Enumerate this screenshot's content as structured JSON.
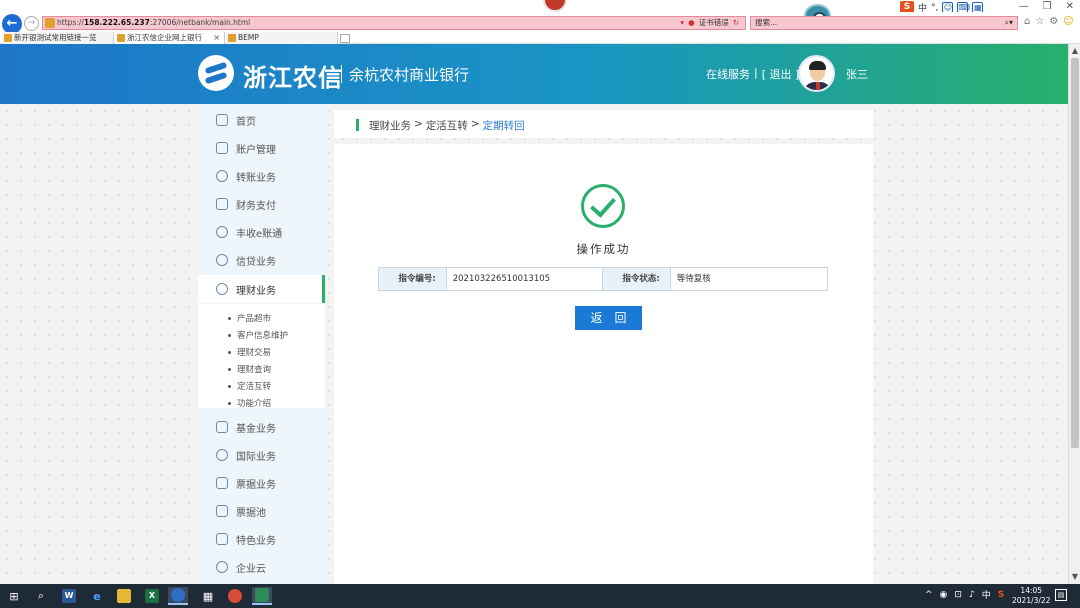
{
  "browser": {
    "url_prefix": "https://",
    "url_host": "158.222.65.237",
    "url_path": ":27006/netbank/main.html",
    "cert_error": "证书错误",
    "search_placeholder": "搜索...",
    "tabs": [
      {
        "label": "新开银测试常用链接一览"
      },
      {
        "label": "浙江农信企业网上银行",
        "close": "×"
      },
      {
        "label": "BEMP"
      }
    ]
  },
  "ime": {
    "lang": "中",
    "punct": "°,"
  },
  "header": {
    "bank_name": "浙江农信",
    "bank_subtitle": "余杭农村商业银行",
    "online_service": "在线服务",
    "separator": "|",
    "logout": "[ 退出 ]",
    "user_name": "张三"
  },
  "sidebar": {
    "items": [
      {
        "label": "首页"
      },
      {
        "label": "账户管理"
      },
      {
        "label": "转账业务"
      },
      {
        "label": "财务支付"
      },
      {
        "label": "丰收e账通"
      },
      {
        "label": "信贷业务"
      },
      {
        "label": "理财业务"
      },
      {
        "label": "基金业务"
      },
      {
        "label": "国际业务"
      },
      {
        "label": "票据业务"
      },
      {
        "label": "票据池"
      },
      {
        "label": "特色业务"
      },
      {
        "label": "企业云"
      }
    ],
    "sub_items": [
      {
        "label": "产品超市"
      },
      {
        "label": "客户信息维护"
      },
      {
        "label": "理财交易"
      },
      {
        "label": "理财查询"
      },
      {
        "label": "定活互转"
      },
      {
        "label": "功能介绍"
      }
    ]
  },
  "breadcrumb": {
    "level1": "理财业务",
    "sep": ">",
    "level2": "定活互转",
    "current": "定期转回"
  },
  "result": {
    "message": "操作成功",
    "instruction_no_label": "指令编号:",
    "instruction_no_value": "202103226510013105",
    "instruction_status_label": "指令状态:",
    "instruction_status_value": "等待复核",
    "back_button": "返回"
  },
  "taskbar": {
    "time": "14:05",
    "date": "2021/3/22",
    "ime": "中"
  },
  "colors": {
    "header_start": "#1e76c9",
    "header_end": "#27b06b",
    "accent_green": "#27b06b",
    "primary_button": "#1a7ad6",
    "link_blue": "#2c7fd0"
  }
}
